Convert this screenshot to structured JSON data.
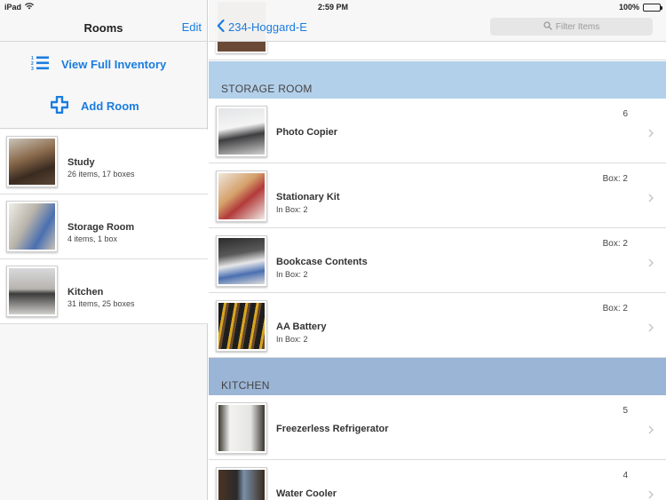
{
  "status": {
    "carrier": "iPad",
    "time": "2:59 PM",
    "battery": "100%"
  },
  "sidebar": {
    "title": "Rooms",
    "edit_label": "Edit",
    "view_inventory_label": "View Full Inventory",
    "add_room_label": "Add Room",
    "rooms": [
      {
        "name": "Study",
        "meta": "26 items, 17 boxes"
      },
      {
        "name": "Storage Room",
        "meta": "4 items, 1 box"
      },
      {
        "name": "Kitchen",
        "meta": "31 items, 25 boxes"
      }
    ]
  },
  "detail": {
    "back_label": "234-Hoggard-E",
    "filter_placeholder": "Filter Items",
    "sections": [
      {
        "title": "STORAGE ROOM",
        "items": [
          {
            "name": "Photo Copier",
            "sub": "",
            "qty": "6"
          },
          {
            "name": "Stationary Kit",
            "sub": "In Box: 2",
            "qty": "Box: 2"
          },
          {
            "name": "Bookcase Contents",
            "sub": "In Box: 2",
            "qty": "Box: 2"
          },
          {
            "name": "AA Battery",
            "sub": "In Box: 2",
            "qty": "Box: 2"
          }
        ]
      },
      {
        "title": "KITCHEN",
        "items": [
          {
            "name": "Freezerless Refrigerator",
            "sub": "",
            "qty": "5"
          },
          {
            "name": "Water Cooler",
            "sub": "",
            "qty": "4"
          }
        ]
      }
    ]
  },
  "colors": {
    "accent": "#1a7ce0",
    "storage_header": "#b3d0ea",
    "kitchen_header": "#9bb5d6"
  }
}
